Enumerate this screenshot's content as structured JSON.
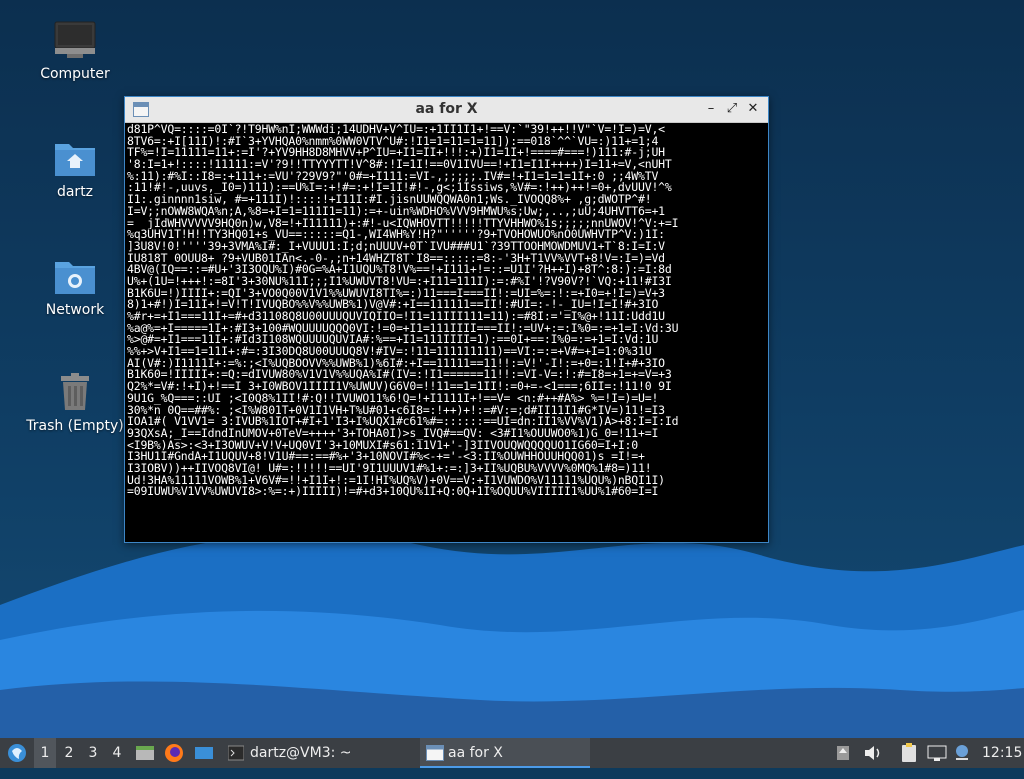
{
  "desktop": {
    "icons": [
      {
        "label": "Computer"
      },
      {
        "label": "dartz"
      },
      {
        "label": "Network"
      },
      {
        "label": "Trash (Empty)"
      }
    ]
  },
  "window": {
    "title": "aa for X",
    "controls": {
      "minimize": "–",
      "maximize": "⤢",
      "close": "✕"
    },
    "console_lines": [
      "d81P^VQ=::::=0I`?!T9HW%nI;WWWdi;14UDHV+V^IU=:+1II1I1+!==V:`\"39!++!!V\"`V=!I=)=V,<",
      "8TV6=:+I[11I)!:#I`3+YVHQA0%nmm%0WW0VTV^U#:!I1=1=11=1=11]):==018`^^`VU=:)11+=1;4",
      "TF%=!I=11111=11+:=I'?+YV9HH8D8MHVV+P^IU=+I1=II+!!!:+)I1=1I+!====#===!)111:#-j;UH",
      "'8:I=1+!::::!11111:=V'?9!!TTYYYTT!V^8#:!I=1I!==0V1IVU==!+I1=I1I++++)I=11+=V,<nUHT",
      "%:11):#%I::I8=:+111+:=VU'?29V9?\"'0#=+I111:=VI-,;;;;;.IV#=!+I1=1=1=1I+:0 ;;4W%TV",
      ":11!#!-,uuvs,_I0=)111):==U%I=:+!#=:+!I=1I!#!-,g<;1Issiws,%V#=:!++)++!=0+,dvUUV!^%",
      "I1:.ginnnn1siw, #=+111I)!::::!+I11I:#I.jisnUUWQQWA0n1;Ws._IVOQQ8%+ ,g;dWOTP^#!",
      "I=V;;nOWW8WQA%n;A,%8=+I=1=111I1=11):=+-uin%WDHO%VVV9HMWU%s;Uw;,..,;uU;4UHVTT6=+1",
      "= _jIdWHVVVVV9HQ0n)w,V8=!+I11111)+:#!-u<IQWHOVTT!!!!!TTYVHHWO%1s;;;;;nnUWOV!^V:+=I",
      "%q3UHV1T!H!!TY3HQ01+s_VU==:::::=Q1-,WI4WH%Y!H?\"'''''?9+TVOHOWUO%nO0UWHVTP^V:)1I:",
      "]3U8V!0!''''39+3VMA%I#:_I+VUUU1:I;d;nUUUV+0T`IVU###U1`?39TTOOHMOWDMUV1+T`8:I=I:V",
      "IU818T 0OUU8+ ?9+VUB01IAn<.-0-,;n+14WHZT8T`I8==:::::=8:-'3H+T1VV%VVT+8!V=:I=)=Vd",
      "4BV@(IQ==::=#U+'3I3OQU%I)#0G=%A+I1UQU%T8!V%==!+I111+!=::=U1I'?H++I)+8T^:8:):=I:8d",
      "U%+(1U=!+++!:=8I'3+30NU%11I;;;I1%UWUVT8!VU=:+I11=111I):=:#%I'!?V90V?!`VQ:+11!#I3I",
      "B1K6U=!)IIII+:=QI'3+VO0Q00V1V1%%UWUVI8TI%=:)11===I===II!:=UI=%=:!:=+I0=+!I=)=V+3",
      "8)1+#!)I=11I+!=V!T!IVUQBO%%V%%UWB%1)V@V#:+I==111111==II!:#UI=:-!-_IU=!I=I!#+3IO",
      "%#r+=+I1===11I+=#+d31108Q8U00UUUQUVIQIIO=!I1=11III111=11):=#8I:='=I%@+!11I:Udd1U",
      "%a@%=+I=====1I+:#I3+100#WQUUUUQQQ0VI:!=0=+I1=111IIII===II!:=UV+:=:I%0=:=+1=I:Vd:3U",
      "%>@#=+I1===11I+:#Id3I108WQUUUUQUVIA#:%==+I1=111IIII=1):==0I+==:I%0=:=+1=I:Vd:1U",
      "%%+>V+I1==1=11I+:#=:3I30DQ8U00UUUQ8V!#IV=:!11=111111111)==VI:=:=+V#=+I=1:0%31U",
      "AI(V#:)I1111I+:=%:;<I%UQBOOVV%%UWB%1)%6I#:+I==11111==11!!:=V!'-I!:=+0=:1!I+#+3IO",
      "B1K60=!IIIII+:=Q:=dIVUW80%V1V1V%%UQA%I#(IV=:!I1======11!!:=VI-V=:!:#=I8=+1=+=V=+3",
      "Q2%*=V#:!+I)+!==I 3+I0WBOV1IIII1V%UWUV)G6V0=!!11==1=1II!:=0+=-<1===;6II=:!11!0 9I",
      "9U1G_%Q===::UI ;<I0Q8%1II!#:Q!!IVUWO11%6!Q=!+I1111I+!==V= <n:#++#A%> %=!I=)=U=!",
      "30%*n 0Q==##%: ;<I%W801T+0V1I1VH+T%U#01+c6I8=:!++)+!:=#V:=;d#II11I1#G*IV=)11!=I3",
      "IOA1#( V1VV1= 3:IVUB%1IOT+#I+1'I3+I%UQX1#c61%#=::::::==UI=dn:II1%VV%V1)A>+8:I=I:Id",
      "93QXsA;_I==IdndInUMOV+0TeV=++++'3+TOHA0I)>s_IVQ#==QV: <3#I1%OUUWO0%1)G_0=!11+=I",
      "<I9B%)As>:<3+I3OWUV+V!V+UQ0VI'3+10MUXI#s61:11V1+'-]3IIVOUQWQQQQUO1IG60=I+I:0",
      "I3HU1I#GndA+I1UQUV+8!V1U#==:==#%+'3+10NOVI#%<-+='-<3:II%OUWHHOUUHQQ01)s =I!=+",
      "I3IOBV))++IIVOQ8VI@! U#=:!!!!!==UI'9I1UUUV1#%1+:=:]3+II%UQBU%VVVV%0MQ%1#8=)11!",
      "Ud!3HA%11111VOWB%1+V6V#=!!+I1I+!:=1I!HI%UQ%V)+0V==V:+I1VUWDO%V11111%UQU%)nBQI1I)",
      "=09IUWU%V1VV%UWUVI8>:%=:+)IIIII)!=#+d3+10QU%1I+Q:0Q+1I%OQUU%VIIIII1%UU%1#60=I=I"
    ]
  },
  "taskbar": {
    "workspaces": [
      "1",
      "2",
      "3",
      "4"
    ],
    "tasks": [
      {
        "label": "dartz@VM3: ~"
      },
      {
        "label": "aa for X"
      }
    ],
    "clock": "12:15"
  }
}
